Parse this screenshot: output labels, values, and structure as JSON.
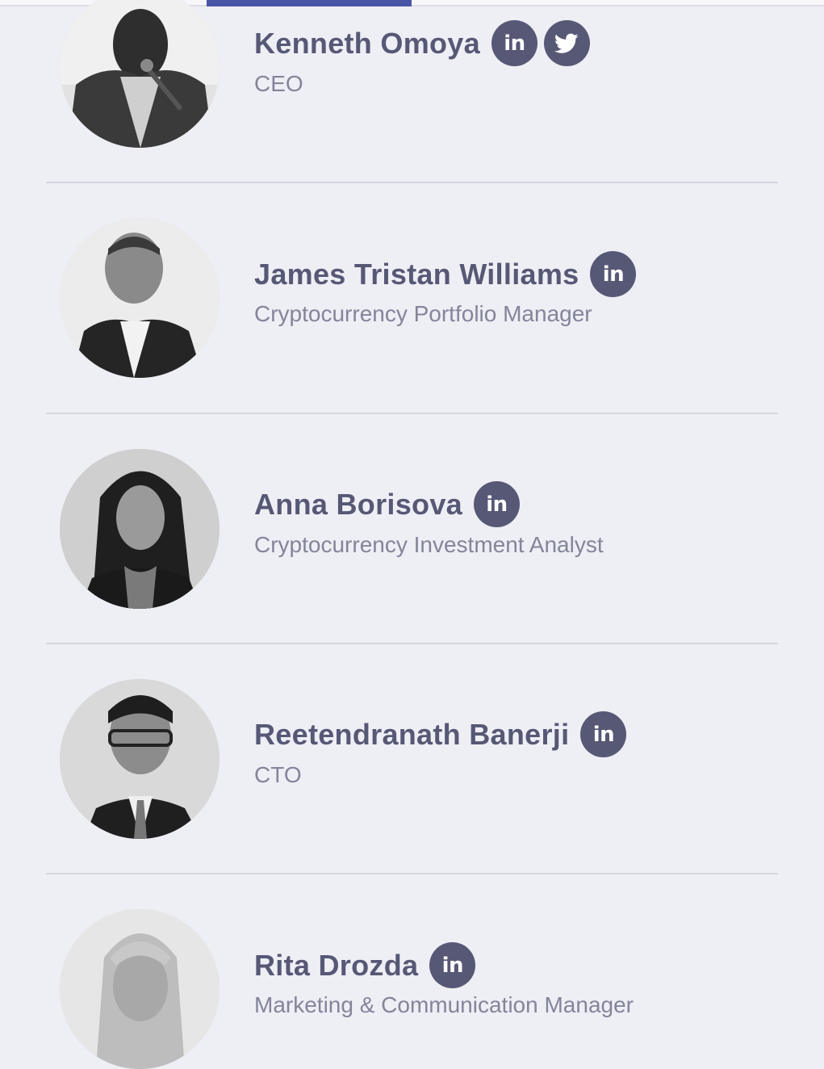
{
  "members": [
    {
      "name": "Kenneth Omoya",
      "role": "CEO",
      "social": [
        "linkedin",
        "twitter"
      ]
    },
    {
      "name": "James Tristan Williams",
      "role": "Cryptocurrency Portfolio Manager",
      "social": [
        "linkedin"
      ]
    },
    {
      "name": "Anna Borisova",
      "role": "Cryptocurrency Investment Analyst",
      "social": [
        "linkedin"
      ]
    },
    {
      "name": "Reetendranath Banerji",
      "role": "CTO",
      "social": [
        "linkedin"
      ]
    },
    {
      "name": "Rita Drozda",
      "role": "Marketing & Communication Manager",
      "social": [
        "linkedin"
      ]
    }
  ],
  "social_labels": {
    "linkedin": "in"
  },
  "colors": {
    "background": "#eeeef5",
    "name_text": "#565875",
    "role_text": "#83859a",
    "social_button": "#565875",
    "divider": "#d6d6e0",
    "active_tab": "#4a54a6"
  }
}
